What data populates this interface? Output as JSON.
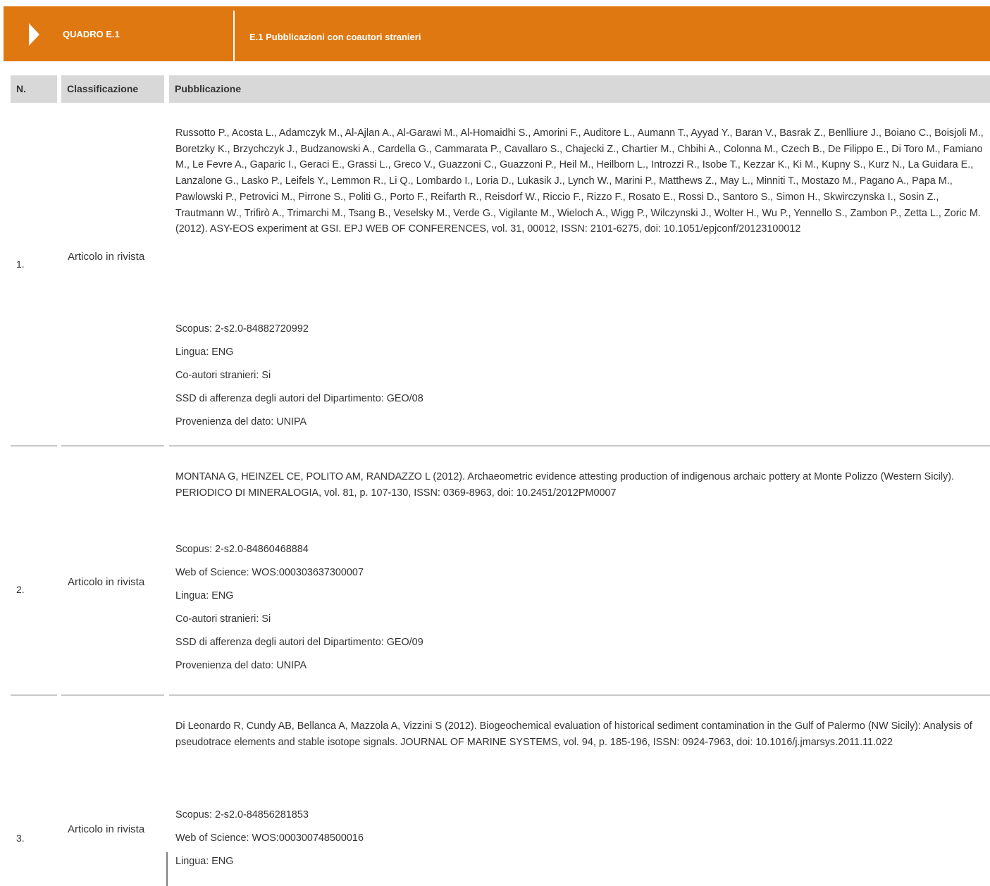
{
  "header": {
    "code": "QUADRO E.1",
    "title": "E.1 Pubblicazioni con coautori stranieri",
    "icon": "chevron-right-icon",
    "color": "#e07811"
  },
  "table": {
    "columns": [
      "N.",
      "Classificazione",
      "Pubblicazione"
    ],
    "rows": [
      {
        "n": "1.",
        "classification": "Articolo in rivista",
        "citation": "Russotto P., Acosta L., Adamczyk M., Al-Ajlan A., Al-Garawi M., Al-Homaidhi S., Amorini F., Auditore L., Aumann T., Ayyad Y., Baran V., Basrak Z., Benlliure J., Boiano C., Boisjoli M., Boretzky K., Brzychczyk J., Budzanowski A., Cardella G., Cammarata P., Cavallaro S., Chajecki Z., Chartier M., Chbihi A., Colonna M., Czech B., De Filippo E., Di Toro M., Famiano M., Le Fevre A., Gaparic I., Geraci E., Grassi L., Greco V., Guazzoni C., Guazzoni P., Heil M., Heilborn L., Introzzi R., Isobe T., Kezzar K., Ki M., Kupny S., Kurz N., La Guidara E., Lanzalone G., Lasko P., Leifels Y., Lemmon R., Li Q., Lombardo I., Loria D., Lukasik J., Lynch W., Marini P., Matthews Z., May L., Minniti T., Mostazo M., Pagano A., Papa M., Pawlowski P., Petrovici M., Pirrone S., Politi G., Porto F., Reifarth R., Reisdorf W., Riccio F., Rizzo F., Rosato E., Rossi D., Santoro S., Simon H., Skwirczynska I., Sosin Z., Trautmann W., Trifirò A., Trimarchi M., Tsang B., Veselsky M., Verde G., Vigilante M., Wieloch A., Wigg P., Wilczynski J., Wolter H., Wu P., Yennello S., Zambon P., Zetta L., Zoric M. (2012). ASY-EOS experiment at GSI. EPJ WEB OF CONFERENCES, vol. 31, 00012, ISSN: 2101-6275, doi: 10.1051/epjconf/20123100012",
        "meta": [
          "Scopus: 2-s2.0-84882720992",
          "Lingua: ENG",
          "Co-autori stranieri: Si",
          "SSD di afferenza degli autori del Dipartimento: GEO/08",
          "Provenienza del dato: UNIPA"
        ]
      },
      {
        "n": "2.",
        "classification": "Articolo in rivista",
        "citation": "MONTANA G, HEINZEL CE, POLITO AM, RANDAZZO L (2012). Archaeometric evidence attesting production of indigenous archaic pottery at Monte Polizzo (Western Sicily). PERIODICO DI MINERALOGIA, vol. 81, p. 107-130, ISSN: 0369-8963, doi: 10.2451/2012PM0007",
        "meta": [
          "Scopus: 2-s2.0-84860468884",
          "Web of Science: WOS:000303637300007",
          "Lingua: ENG",
          "Co-autori stranieri: Si",
          "SSD di afferenza degli autori del Dipartimento: GEO/09",
          "Provenienza del dato: UNIPA"
        ]
      },
      {
        "n": "3.",
        "classification": "Articolo in rivista",
        "citation": "Di Leonardo R, Cundy AB, Bellanca A, Mazzola A, Vizzini S (2012). Biogeochemical evaluation of historical sediment contamination in the Gulf of Palermo (NW Sicily): Analysis of pseudotrace elements and stable isotope signals. JOURNAL OF MARINE SYSTEMS, vol. 94, p. 185-196, ISSN: 0924-7963, doi: 10.1016/j.jmarsys.2011.11.022",
        "meta": [
          "Scopus: 2-s2.0-84856281853",
          "Web of Science: WOS:000300748500016",
          "Lingua: ENG"
        ]
      }
    ]
  }
}
